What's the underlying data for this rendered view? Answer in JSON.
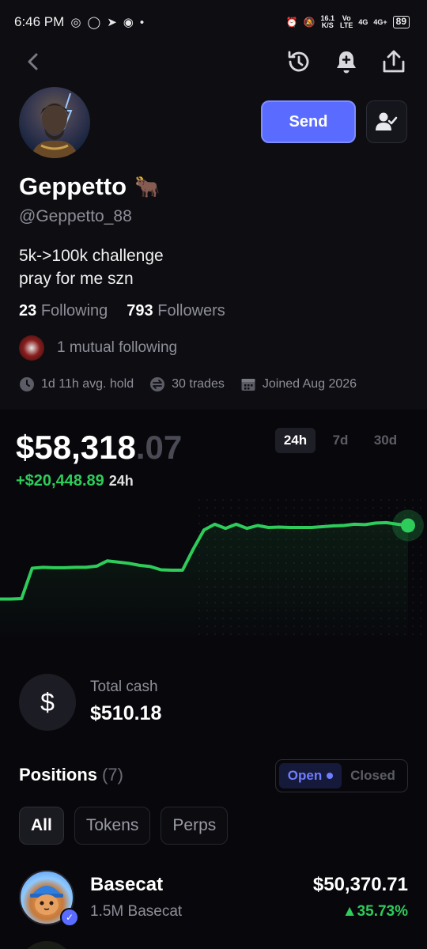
{
  "status_bar": {
    "time": "6:46 PM",
    "net_speed": "16.1",
    "net_unit": "K/S",
    "volte_top": "Vo",
    "volte_bottom": "LTE",
    "sig1": "4G",
    "sig2": "4G+",
    "battery": "89"
  },
  "profile": {
    "name": "Geppetto",
    "emoji": "🐂",
    "handle": "@Geppetto_88",
    "bio_line1": "5k->100k challenge",
    "bio_line2": "pray for me szn",
    "following_count": "23",
    "following_label": "Following",
    "followers_count": "793",
    "followers_label": "Followers",
    "mutual": "1 mutual following",
    "avg_hold": "1d 11h avg. hold",
    "trades": "30 trades",
    "joined": "Joined Aug 2026"
  },
  "actions": {
    "send_label": "Send"
  },
  "portfolio": {
    "balance_main": "$58,318",
    "balance_cents": ".07",
    "pnl_value": "+$20,448.89",
    "pnl_period": "24h",
    "range_tabs": [
      "24h",
      "7d",
      "30d"
    ],
    "active_range": "24h"
  },
  "chart_data": {
    "type": "line",
    "series": [
      {
        "values": [
          40.2,
          40.2,
          40.3,
          47.8,
          48.0,
          47.9,
          47.9,
          48.0,
          48.0,
          48.3,
          49.6,
          49.3,
          49.0,
          48.5,
          48.2,
          47.4,
          47.3,
          47.3,
          52.5,
          57.2,
          58.6,
          57.6,
          58.6,
          57.6,
          58.3,
          57.8,
          57.9,
          57.8,
          57.8,
          57.8,
          58.0,
          58.2,
          58.3,
          58.6,
          58.5,
          58.9,
          59.0,
          58.6,
          58.3
        ]
      }
    ],
    "ylim": [
      30,
      65
    ],
    "grid": false
  },
  "cash": {
    "label": "Total cash",
    "value": "$510.18",
    "icon": "dollar-icon"
  },
  "positions": {
    "title": "Positions",
    "count": "(7)",
    "toggle_open": "Open",
    "toggle_closed": "Closed",
    "filters": [
      "All",
      "Tokens",
      "Perps"
    ],
    "items": [
      {
        "name": "Basecat",
        "amount": "1.5M Basecat",
        "value": "$50,370.71",
        "change": "▲35.73%"
      }
    ]
  },
  "colors": {
    "accent": "#5a6cff",
    "positive": "#2ecc5a",
    "background": "#0d0d12"
  }
}
